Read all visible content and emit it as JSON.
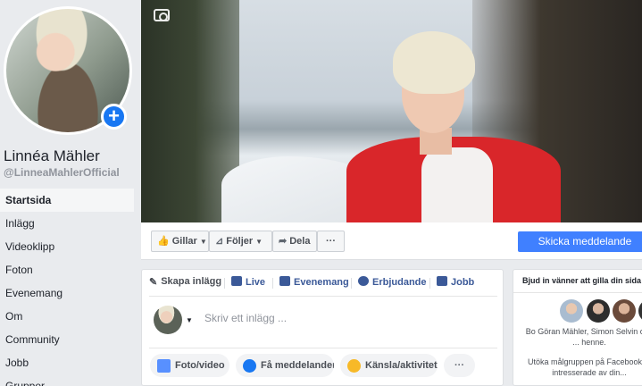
{
  "profile": {
    "name": "Linnéa Mähler",
    "handle": "@LinneaMahlerOfficial"
  },
  "nav": [
    {
      "label": "Startsida",
      "active": true
    },
    {
      "label": "Inlägg"
    },
    {
      "label": "Videoklipp"
    },
    {
      "label": "Foton"
    },
    {
      "label": "Evenemang"
    },
    {
      "label": "Om"
    },
    {
      "label": "Community"
    },
    {
      "label": "Jobb"
    },
    {
      "label": "Grupper"
    }
  ],
  "actions": {
    "like": "Gillar",
    "follow": "Följer",
    "share": "Dela",
    "more": "···",
    "message": "Skicka meddelande"
  },
  "composer": {
    "tabs": {
      "create": "Skapa inlägg",
      "live": "Live",
      "events": "Evenemang",
      "offer": "Erbjudande",
      "jobs": "Jobb"
    },
    "placeholder": "Skriv ett inlägg ...",
    "pills": {
      "photo": "Foto/video",
      "message": "Få meddelanden",
      "feeling": "Känsla/aktivitet",
      "more": "···"
    }
  },
  "invite": {
    "title": "Bjud in vänner att gilla din sida",
    "names": "Bo Göran Mähler, Simon Selvin och ... henne.",
    "promo": "Utöka målgruppen på Facebook ... intresserade av din..."
  },
  "colors": {
    "accent": "#4080ff",
    "link": "#3b5998",
    "background": "#e9ebee"
  }
}
